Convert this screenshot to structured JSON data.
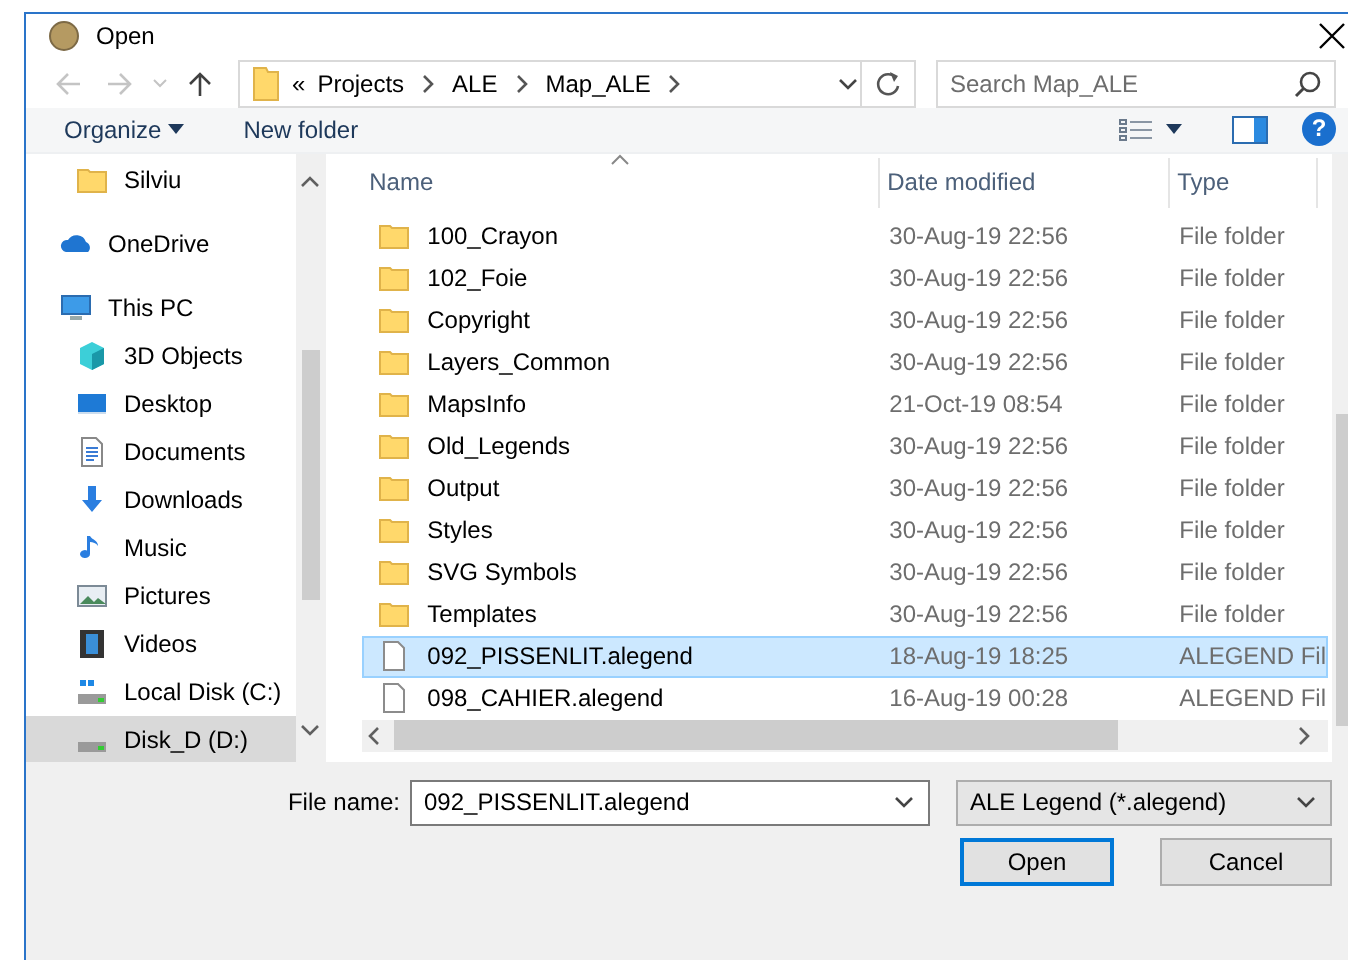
{
  "window": {
    "title": "Open"
  },
  "nav_buttons": [
    {
      "kind": "back",
      "disabled": true
    },
    {
      "kind": "forward",
      "disabled": true
    },
    {
      "kind": "recent",
      "disabled": true
    },
    {
      "kind": "up",
      "disabled": false
    }
  ],
  "address_bar": {
    "overflow": "«",
    "segments": [
      "Projects",
      "ALE",
      "Map_ALE"
    ]
  },
  "search": {
    "placeholder": "Search Map_ALE"
  },
  "toolbar": {
    "organize": "Organize",
    "new_folder": "New folder",
    "help": "?"
  },
  "nav_pane": {
    "items": [
      {
        "children": [
          {
            "label": "Silviu",
            "kind": "folder",
            "selected": false
          }
        ]
      },
      {
        "label": "OneDrive",
        "kind": "cloud",
        "selected": false
      },
      {
        "label": "This PC",
        "kind": "pc",
        "selected": false,
        "children": [
          {
            "label": "3D Objects",
            "kind": "cube",
            "selected": false
          },
          {
            "label": "Desktop",
            "kind": "desktop",
            "selected": false
          },
          {
            "label": "Documents",
            "kind": "document",
            "selected": false
          },
          {
            "label": "Downloads",
            "kind": "download",
            "selected": false
          },
          {
            "label": "Music",
            "kind": "music",
            "selected": false
          },
          {
            "label": "Pictures",
            "kind": "pictures",
            "selected": false
          },
          {
            "label": "Videos",
            "kind": "videos",
            "selected": false
          },
          {
            "label": "Local Disk (C:)",
            "kind": "system_drive",
            "selected": false
          },
          {
            "label": "Disk_D (D:)",
            "kind": "drive",
            "selected": true
          }
        ]
      }
    ]
  },
  "file_list": {
    "columns": [
      {
        "label": "Name",
        "sorted": true
      },
      {
        "label": "Date modified",
        "sorted": false
      },
      {
        "label": "Type",
        "sorted": false
      }
    ],
    "rows": [
      {
        "name": "100_Crayon",
        "date": "30-Aug-19 22:56",
        "type": "File folder",
        "kind": "folder",
        "selected": false
      },
      {
        "name": "102_Foie",
        "date": "30-Aug-19 22:56",
        "type": "File folder",
        "kind": "folder",
        "selected": false
      },
      {
        "name": "Copyright",
        "date": "30-Aug-19 22:56",
        "type": "File folder",
        "kind": "folder",
        "selected": false
      },
      {
        "name": "Layers_Common",
        "date": "30-Aug-19 22:56",
        "type": "File folder",
        "kind": "folder",
        "selected": false
      },
      {
        "name": "MapsInfo",
        "date": "21-Oct-19 08:54",
        "type": "File folder",
        "kind": "folder",
        "selected": false
      },
      {
        "name": "Old_Legends",
        "date": "30-Aug-19 22:56",
        "type": "File folder",
        "kind": "folder",
        "selected": false
      },
      {
        "name": "Output",
        "date": "30-Aug-19 22:56",
        "type": "File folder",
        "kind": "folder",
        "selected": false
      },
      {
        "name": "Styles",
        "date": "30-Aug-19 22:56",
        "type": "File folder",
        "kind": "folder",
        "selected": false
      },
      {
        "name": "SVG Symbols",
        "date": "30-Aug-19 22:56",
        "type": "File folder",
        "kind": "folder",
        "selected": false
      },
      {
        "name": "Templates",
        "date": "30-Aug-19 22:56",
        "type": "File folder",
        "kind": "folder",
        "selected": false
      },
      {
        "name": "092_PISSENLIT.alegend",
        "date": "18-Aug-19 18:25",
        "type": "ALEGEND Fil",
        "kind": "file",
        "selected": true
      },
      {
        "name": "098_CAHIER.alegend",
        "date": "16-Aug-19 00:28",
        "type": "ALEGEND Fil",
        "kind": "file",
        "selected": false
      }
    ]
  },
  "file_name": {
    "label": "File name:",
    "value": "092_PISSENLIT.alegend"
  },
  "file_type": {
    "value": "ALE Legend (*.alegend)"
  },
  "buttons": [
    {
      "label": "Open",
      "default": true
    },
    {
      "label": "Cancel",
      "default": false
    }
  ]
}
